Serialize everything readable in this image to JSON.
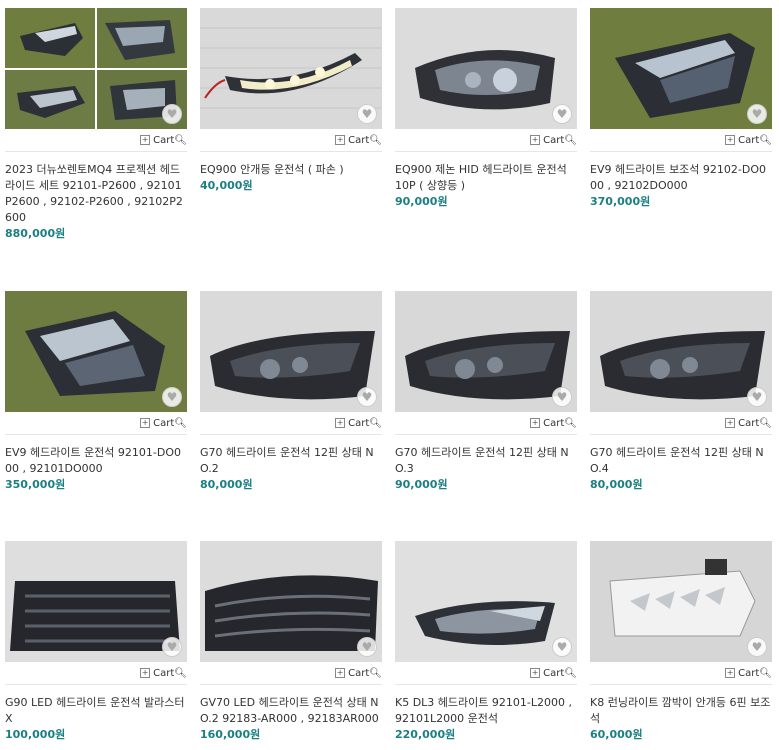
{
  "cart_label": "Cart",
  "wishlist_icon": "heart-icon",
  "products": [
    {
      "title": "2023 더뉴쏘렌토MQ4 프로젝션 헤드라이드 세트 92101-P2600 , 92101P2600 , 92102-P2600 , 92102P2600",
      "price": "880,000원"
    },
    {
      "title": "EQ900 안개등 운전석 ( 파손 )",
      "price": "40,000원"
    },
    {
      "title": "EQ900 제논 HID 헤드라이트 운전석 10P ( 상향등 )",
      "price": "90,000원"
    },
    {
      "title": "EV9 헤드라이트 보조석 92102-DO000 , 92102DO000",
      "price": "370,000원"
    },
    {
      "title": "EV9 헤드라이트 운전석 92101-DO000 , 92101DO000",
      "price": "350,000원"
    },
    {
      "title": "G70 헤드라이트 운전석 12핀 상태 NO.2",
      "price": "80,000원"
    },
    {
      "title": "G70 헤드라이트 운전석 12핀 상태 NO.3",
      "price": "90,000원"
    },
    {
      "title": "G70 헤드라이트 운전석 12핀 상태 NO.4",
      "price": "80,000원"
    },
    {
      "title": "G90 LED 헤드라이트 운전석 발라스터 X",
      "price": "100,000원"
    },
    {
      "title": "GV70 LED 헤드라이트 운전석 상태 NO.2 92183-AR000 , 92183AR000",
      "price": "160,000원"
    },
    {
      "title": "K5 DL3 헤드라이트 92101-L2000 , 92101L2000 운전석",
      "price": "220,000원"
    },
    {
      "title": "K8 런닝라이트 깜박이 안개등 6핀 보조석",
      "price": "60,000원"
    }
  ]
}
